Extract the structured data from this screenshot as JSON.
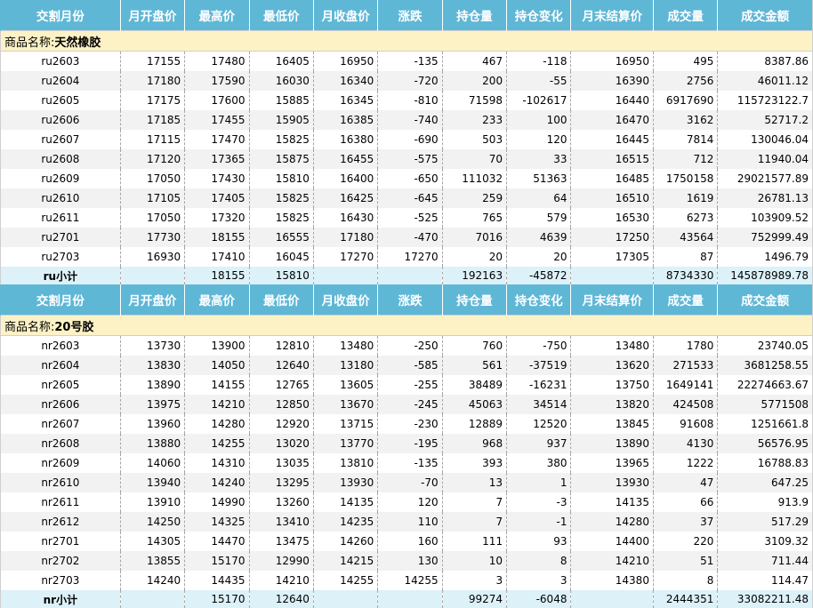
{
  "columns": [
    "交割月份",
    "月开盘价",
    "最高价",
    "最低价",
    "月收盘价",
    "涨跌",
    "持仓量",
    "持仓变化",
    "月末结算价",
    "成交量",
    "成交金额"
  ],
  "sections": [
    {
      "group_prefix": "商品名称:",
      "group_name": "天然橡胶",
      "rows": [
        [
          "ru2603",
          "17155",
          "17480",
          "16405",
          "16950",
          "-135",
          "467",
          "-118",
          "16950",
          "495",
          "8387.86"
        ],
        [
          "ru2604",
          "17180",
          "17590",
          "16030",
          "16340",
          "-720",
          "200",
          "-55",
          "16390",
          "2756",
          "46011.12"
        ],
        [
          "ru2605",
          "17175",
          "17600",
          "15885",
          "16345",
          "-810",
          "71598",
          "-102617",
          "16440",
          "6917690",
          "115723122.7"
        ],
        [
          "ru2606",
          "17185",
          "17455",
          "15905",
          "16385",
          "-740",
          "233",
          "100",
          "16470",
          "3162",
          "52717.2"
        ],
        [
          "ru2607",
          "17115",
          "17470",
          "15825",
          "16380",
          "-690",
          "503",
          "120",
          "16445",
          "7814",
          "130046.04"
        ],
        [
          "ru2608",
          "17120",
          "17365",
          "15875",
          "16455",
          "-575",
          "70",
          "33",
          "16515",
          "712",
          "11940.04"
        ],
        [
          "ru2609",
          "17050",
          "17430",
          "15810",
          "16400",
          "-650",
          "111032",
          "51363",
          "16485",
          "1750158",
          "29021577.89"
        ],
        [
          "ru2610",
          "17105",
          "17405",
          "15825",
          "16425",
          "-645",
          "259",
          "64",
          "16510",
          "1619",
          "26781.13"
        ],
        [
          "ru2611",
          "17050",
          "17320",
          "15825",
          "16430",
          "-525",
          "765",
          "579",
          "16530",
          "6273",
          "103909.52"
        ],
        [
          "ru2701",
          "17730",
          "18155",
          "16555",
          "17180",
          "-470",
          "7016",
          "4639",
          "17250",
          "43564",
          "752999.49"
        ],
        [
          "ru2703",
          "16930",
          "17410",
          "16045",
          "17270",
          "17270",
          "20",
          "20",
          "17305",
          "87",
          "1496.79"
        ]
      ],
      "subtotal": [
        "ru小计",
        "",
        "18155",
        "15810",
        "",
        "",
        "192163",
        "-45872",
        "",
        "8734330",
        "145878989.78"
      ]
    },
    {
      "group_prefix": "商品名称:",
      "group_name": "20号胶",
      "rows": [
        [
          "nr2603",
          "13730",
          "13900",
          "12810",
          "13480",
          "-250",
          "760",
          "-750",
          "13480",
          "1780",
          "23740.05"
        ],
        [
          "nr2604",
          "13830",
          "14050",
          "12640",
          "13180",
          "-585",
          "561",
          "-37519",
          "13620",
          "271533",
          "3681258.55"
        ],
        [
          "nr2605",
          "13890",
          "14155",
          "12765",
          "13605",
          "-255",
          "38489",
          "-16231",
          "13750",
          "1649141",
          "22274663.67"
        ],
        [
          "nr2606",
          "13975",
          "14210",
          "12850",
          "13670",
          "-245",
          "45063",
          "34514",
          "13820",
          "424508",
          "5771508"
        ],
        [
          "nr2607",
          "13960",
          "14280",
          "12920",
          "13715",
          "-230",
          "12889",
          "12520",
          "13845",
          "91608",
          "1251661.8"
        ],
        [
          "nr2608",
          "13880",
          "14255",
          "13020",
          "13770",
          "-195",
          "968",
          "937",
          "13890",
          "4130",
          "56576.95"
        ],
        [
          "nr2609",
          "14060",
          "14310",
          "13035",
          "13810",
          "-135",
          "393",
          "380",
          "13965",
          "1222",
          "16788.83"
        ],
        [
          "nr2610",
          "13940",
          "14240",
          "13295",
          "13930",
          "-70",
          "13",
          "1",
          "13930",
          "47",
          "647.25"
        ],
        [
          "nr2611",
          "13910",
          "14990",
          "13260",
          "14135",
          "120",
          "7",
          "-3",
          "14135",
          "66",
          "913.9"
        ],
        [
          "nr2612",
          "14250",
          "14325",
          "13410",
          "14235",
          "110",
          "7",
          "-1",
          "14280",
          "37",
          "517.29"
        ],
        [
          "nr2701",
          "14305",
          "14470",
          "13475",
          "14260",
          "160",
          "111",
          "93",
          "14400",
          "220",
          "3109.32"
        ],
        [
          "nr2702",
          "13855",
          "15170",
          "12990",
          "14215",
          "130",
          "10",
          "8",
          "14210",
          "51",
          "711.44"
        ],
        [
          "nr2703",
          "14240",
          "14435",
          "14210",
          "14255",
          "14255",
          "3",
          "3",
          "14380",
          "8",
          "114.47"
        ]
      ],
      "subtotal": [
        "nr小计",
        "",
        "15170",
        "12640",
        "",
        "",
        "99274",
        "-6048",
        "",
        "2444351",
        "33082211.48"
      ]
    }
  ]
}
